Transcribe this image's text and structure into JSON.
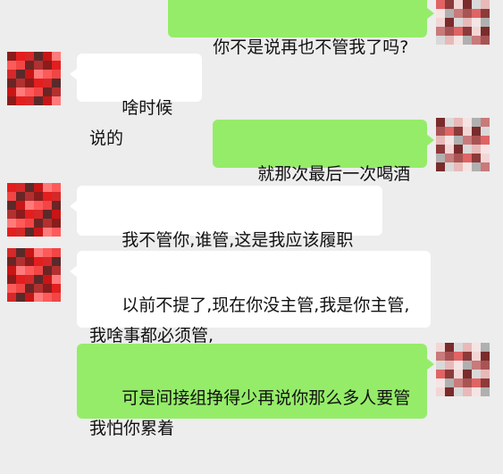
{
  "messages": [
    {
      "side": "right",
      "text": "你不是说再也不管我了吗?"
    },
    {
      "side": "left",
      "text": "啥时候说的"
    },
    {
      "side": "right",
      "text": "就那次最后一次喝酒"
    },
    {
      "side": "left",
      "text": "我不管你,谁管,这是我应该履职"
    },
    {
      "side": "left",
      "text": "以前不提了,现在你没主管,我是你主管,我啥事都必须管,"
    },
    {
      "side": "right",
      "text": "可是间接组挣得少再说你那么多人要管我怕你累着"
    }
  ],
  "colors": {
    "background": "#ededed",
    "self_bubble": "#95ec69",
    "other_bubble": "#ffffff"
  },
  "avatars": {
    "self": "pixelated-avatar-muted",
    "other": "pixelated-avatar-red"
  }
}
